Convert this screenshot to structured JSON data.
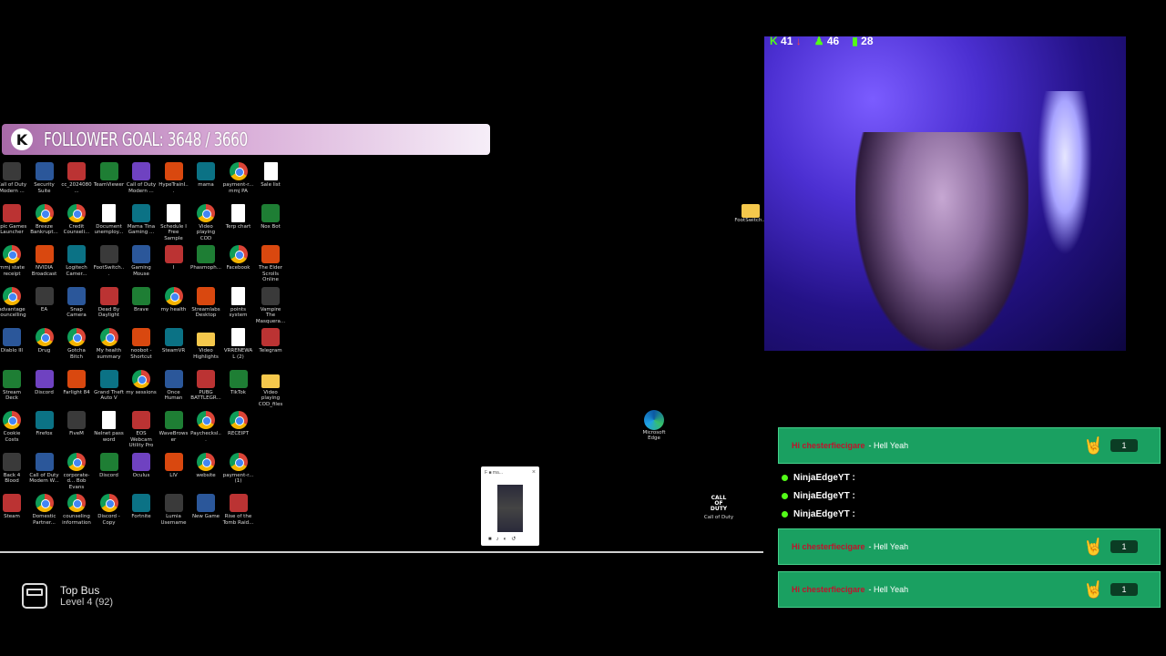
{
  "follower_goal": {
    "logo": "K",
    "text": "FOLLOWER GOAL: 3648 / 3660"
  },
  "stream_stats": {
    "kick_count": "41",
    "followers": "46",
    "viewers": "28"
  },
  "desktop_icons": [
    [
      "Call of Duty Modern ...",
      "Security Suite",
      "cc_2024080...",
      "TeamViewer",
      "Call of Duty Modern ...",
      "HypeTrainI...",
      "mama",
      "payment-r... mmj PA",
      "Sale list"
    ],
    [
      "Epic Games Launcher",
      "Breeze Bankrupt...",
      "Credit Counseli...",
      "Document unemploy...",
      "Mama Tina Gaming ...",
      "Schedule I Free Sample",
      "Video playing COD",
      "Terp chart",
      "Nox Bot"
    ],
    [
      "mmj state receipt",
      "NVIDIA Broadcast",
      "Logitech Camer...",
      "FootSwitch...",
      "Gaming Mouse",
      "I",
      "Phasmoph...",
      "Facebook",
      "The Elder Scrolls Online"
    ],
    [
      "advantage councelling",
      "EA",
      "Snap Camera",
      "Dead By Daylight",
      "Brave",
      "my health",
      "Streamlabs Desktop",
      "points system",
      "Vampire The Masquera..."
    ],
    [
      "Diablo III",
      "Drug",
      "Gotcha Bitch",
      "My health summary",
      "noobot - Shortcut",
      "SteamVR",
      "Video Highlights",
      "VRRENEWAL (2)",
      "Telegram"
    ],
    [
      "Stream Deck",
      "Discord",
      "Farlight 84",
      "Grand Theft Auto V",
      "my sessions",
      "Once Human",
      "PUBG BATTLEGR...",
      "TikTok",
      "Video playing COD_files"
    ],
    [
      "Cookie Costs",
      "Firefox",
      "FiveM",
      "Nelnet pass word",
      "EOS Webcam Utility Pro",
      "WaveBrowser",
      "Paychecksl...",
      "RECEIPT"
    ],
    [
      "Back 4 Blood",
      "Call of Duty Modern W...",
      "corporate-d... Bob Evans",
      "Discord",
      "Oculus",
      "LIV",
      "website",
      "payment-r... (1)"
    ],
    [
      "Steam",
      "Domestic Partner...",
      "counseling information",
      "Discord - Copy",
      "Fortnite",
      "Lumia Username",
      "New Game",
      "Rise of the Tomb Raid..."
    ]
  ],
  "right_desktop": {
    "folder": "FootSwitch...",
    "edge": "Microsoft Edge",
    "cod": "Call of Duty",
    "cod_logo": "CALL OF DUTY"
  },
  "chat": {
    "rows": [
      {
        "user": "Hi chesterfiecigare",
        "msg": "- Hell Yeah",
        "count": "1"
      },
      {
        "user": "Hi chesterfiecigare",
        "msg": "- Hell Yeah",
        "count": "1"
      },
      {
        "user": "Hi chesterfiecigare",
        "msg": "- Hell Yeah",
        "count": "1"
      }
    ],
    "system": [
      "NinjaEdgeYT :",
      "NinjaEdgeYT :",
      "NinjaEdgeYT :"
    ]
  },
  "preview": {
    "title": "F ■ ma...",
    "close": "×"
  },
  "top_bus": {
    "title": "Top Bus",
    "level": "Level 4 (92)"
  }
}
